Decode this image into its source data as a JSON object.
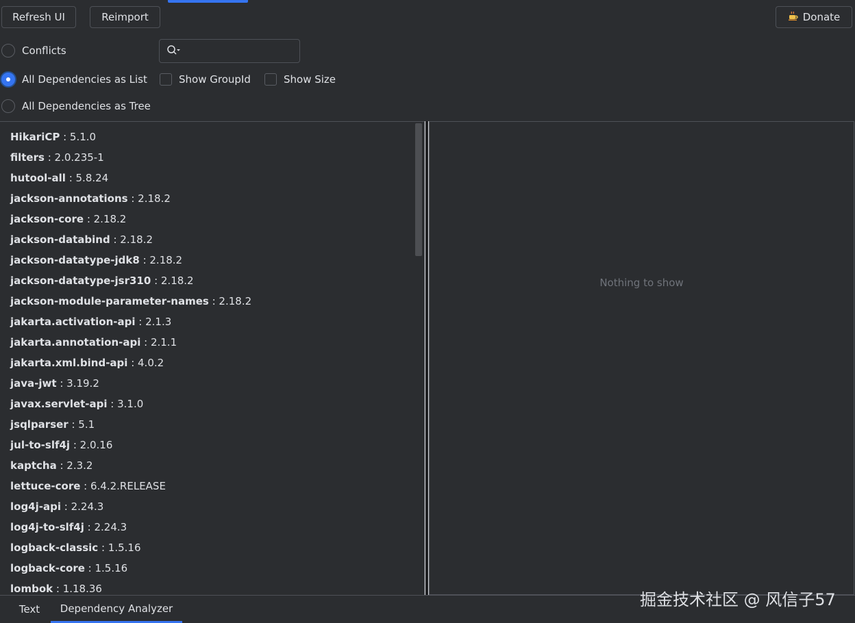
{
  "toolbar": {
    "refresh_label": "Refresh UI",
    "reimport_label": "Reimport",
    "donate_label": "Donate",
    "donate_icon": "coffee-icon"
  },
  "view_mode": {
    "conflicts_label": "Conflicts",
    "list_label": "All Dependencies as List",
    "tree_label": "All Dependencies as Tree",
    "selected": "All Dependencies as List"
  },
  "options": {
    "show_groupid_label": "Show GroupId",
    "show_size_label": "Show Size",
    "show_groupid_checked": false,
    "show_size_checked": false
  },
  "search": {
    "value": "",
    "icon": "search-icon"
  },
  "dependencies": [
    {
      "name": "HikariCP",
      "version": " : 5.1.0"
    },
    {
      "name": "filters",
      "version": " : 2.0.235-1"
    },
    {
      "name": "hutool-all",
      "version": " : 5.8.24"
    },
    {
      "name": "jackson-annotations",
      "version": " : 2.18.2"
    },
    {
      "name": "jackson-core",
      "version": " : 2.18.2"
    },
    {
      "name": "jackson-databind",
      "version": " : 2.18.2"
    },
    {
      "name": "jackson-datatype-jdk8",
      "version": " : 2.18.2"
    },
    {
      "name": "jackson-datatype-jsr310",
      "version": " : 2.18.2"
    },
    {
      "name": "jackson-module-parameter-names",
      "version": " : 2.18.2"
    },
    {
      "name": "jakarta.activation-api",
      "version": " : 2.1.3"
    },
    {
      "name": "jakarta.annotation-api",
      "version": " : 2.1.1"
    },
    {
      "name": "jakarta.xml.bind-api",
      "version": " : 4.0.2"
    },
    {
      "name": "java-jwt",
      "version": " : 3.19.2"
    },
    {
      "name": "javax.servlet-api",
      "version": " : 3.1.0"
    },
    {
      "name": "jsqlparser",
      "version": " : 5.1"
    },
    {
      "name": "jul-to-slf4j",
      "version": " : 2.0.16"
    },
    {
      "name": "kaptcha",
      "version": " : 2.3.2"
    },
    {
      "name": "lettuce-core",
      "version": " : 6.4.2.RELEASE"
    },
    {
      "name": "log4j-api",
      "version": " : 2.24.3"
    },
    {
      "name": "log4j-to-slf4j",
      "version": " : 2.24.3"
    },
    {
      "name": "logback-classic",
      "version": " : 1.5.16"
    },
    {
      "name": "logback-core",
      "version": " : 1.5.16"
    },
    {
      "name": "lombok",
      "version": " : 1.18.36"
    }
  ],
  "details": {
    "empty_text": "Nothing to show"
  },
  "bottom_tabs": {
    "text_label": "Text",
    "analyzer_label": "Dependency Analyzer",
    "active": "Dependency Analyzer"
  },
  "watermark": "掘金技术社区 @ 风信子57",
  "colors": {
    "accent": "#3574f0",
    "background": "#2b2d30",
    "border": "#4e5157"
  }
}
